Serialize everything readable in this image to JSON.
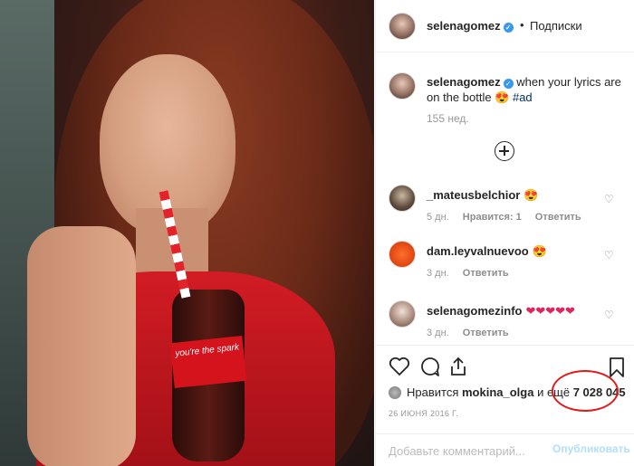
{
  "header": {
    "username": "selenagomez",
    "separator": "•",
    "follow_label": "Подписки"
  },
  "caption": {
    "username": "selenagomez",
    "text": " when your lyrics are on the bottle 😍 ",
    "hashtag": "#ad",
    "time": "155 нед."
  },
  "photo": {
    "bottle_text": "you're the spark"
  },
  "comments": [
    {
      "username": "_mateusbelchior",
      "emoji": "😍",
      "time": "5 дн.",
      "likes": "Нравится: 1",
      "reply": "Ответить"
    },
    {
      "username": "dam.leyvalnuevoo",
      "emoji": "😍",
      "time": "3 дн.",
      "likes": "",
      "reply": "Ответить"
    },
    {
      "username": "selenagomezinfo",
      "emoji": "❤❤❤❤❤",
      "time": "3 дн.",
      "likes": "",
      "reply": "Ответить"
    }
  ],
  "likes": {
    "prefix": "Нравится ",
    "user": "mokina_olga",
    "middle": " и ещё ",
    "count": "7 028 045"
  },
  "date": "26 ИЮНЯ 2016 Г.",
  "comment_box": {
    "placeholder": "Добавьте комментарий...",
    "post_label": "Опубликовать"
  },
  "icons": {
    "verified": "verified-badge",
    "like": "heart-icon",
    "comment": "comment-icon",
    "share": "share-icon",
    "save": "bookmark-icon",
    "load_more": "plus-circle-icon"
  },
  "colors": {
    "link": "#003569",
    "verified": "#3897f0",
    "highlight": "#e11b1b",
    "post_disabled": "#b2dffc"
  }
}
